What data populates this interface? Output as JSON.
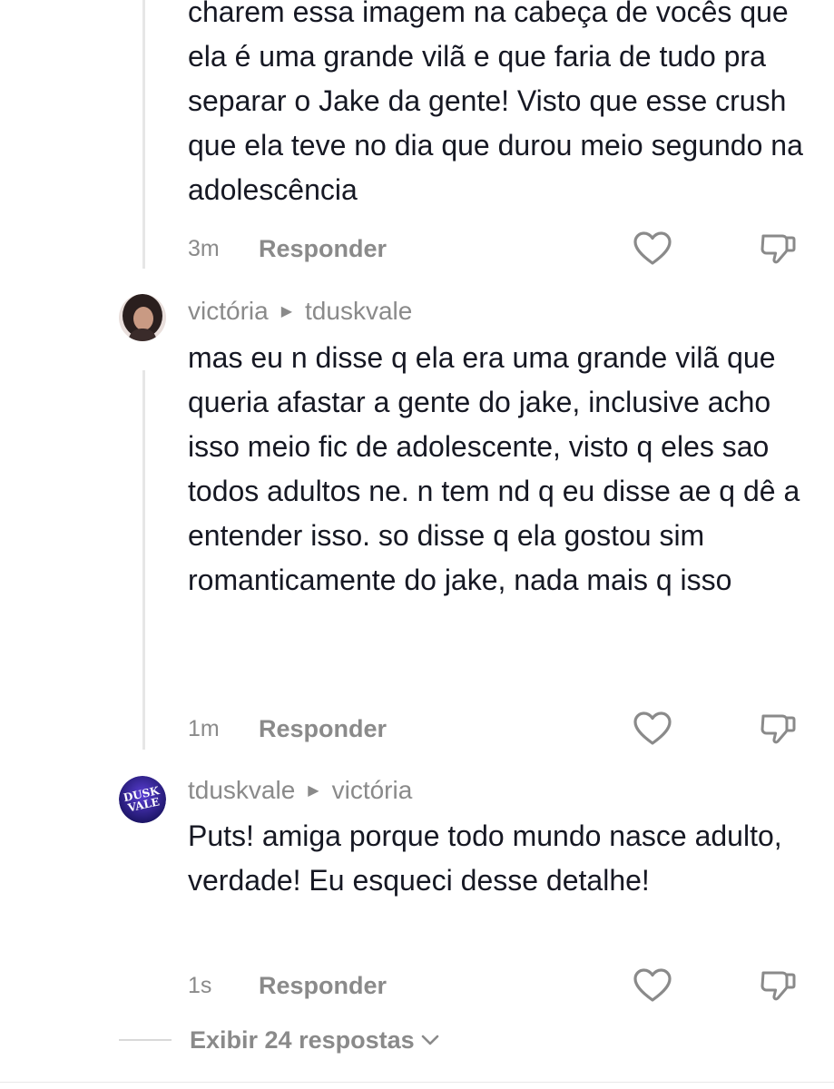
{
  "comments": [
    {
      "body": "charem essa imagem na cabeça de vocês que ela é uma grande vilã e que faria de tudo pra separar o Jake da gente! Visto que esse crush que ela teve no dia que durou meio segundo na adolescência",
      "time": "3m",
      "reply_label": "Responder"
    },
    {
      "author": "victória",
      "reply_to": "tduskvale",
      "body": "mas eu n disse q ela era uma grande vilã que queria afastar a gente do jake, inclusive acho isso meio fic de adolescente, visto q eles sao todos adultos ne. n tem nd q eu disse ae q dê a entender isso. so disse q ela gostou sim romanticamente do jake, nada mais q isso",
      "time": "1m",
      "reply_label": "Responder"
    },
    {
      "author": "tduskvale",
      "reply_to": "victória",
      "avatar_logo_text": "DUSK VALE",
      "body": "Puts! amiga porque todo mundo nasce adulto, verdade! Eu esqueci desse detalhe!",
      "time": "1s",
      "reply_label": "Responder"
    }
  ],
  "view_more_label": "Exibir 24 respostas",
  "colors": {
    "text": "#161823",
    "muted": "#8a8a8a",
    "thread_line": "#e6e6e6"
  }
}
